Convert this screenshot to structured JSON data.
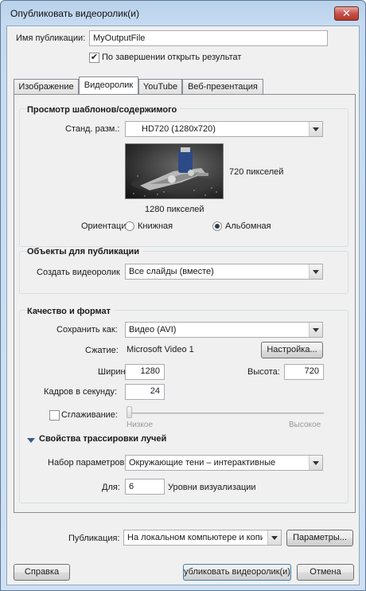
{
  "window": {
    "title": "Опубликовать видеоролик(и)",
    "close_glyph": "✕"
  },
  "publication": {
    "name_label": "Имя публикации:",
    "name_value": "MyOutputFile",
    "open_result_label": "По завершении открыть результат",
    "open_result_checked": true
  },
  "tabs": [
    {
      "label": "Изображение",
      "active": false
    },
    {
      "label": "Видеоролик",
      "active": true
    },
    {
      "label": "YouTube",
      "active": false
    },
    {
      "label": "Веб-презентация",
      "active": false
    }
  ],
  "preview": {
    "group_title": "Просмотр шаблонов/содержимого",
    "size_label": "Станд. разм.:",
    "size_value": "HD720 (1280x720)",
    "height_label": "720 пикселей",
    "width_label": "1280 пикселей",
    "orientation_label": "Ориентация:",
    "portrait_label": "Книжная",
    "landscape_label": "Альбомная",
    "selected_orientation": "landscape"
  },
  "objects": {
    "group_title": "Объекты для публикации",
    "create_label": "Создать видеоролик",
    "create_value": "Все слайды (вместе)"
  },
  "quality": {
    "group_title": "Качество и формат",
    "save_as_label": "Сохранить как:",
    "save_as_value": "Видео (AVI)",
    "compression_label": "Сжатие:",
    "compression_value": "Microsoft Video 1",
    "settings_button": "Настройка...",
    "width_label": "Ширина:",
    "width_value": "1280",
    "height_label": "Высота:",
    "height_value": "720",
    "fps_label": "Кадров в секунду:",
    "fps_value": "24",
    "smoothing_label": "Сглаживание:",
    "smoothing_checked": false,
    "slider_low": "Низкое",
    "slider_high": "Высокое",
    "slider_level": 0
  },
  "raytrace": {
    "title": "Свойства трассировки лучей",
    "preset_label": "Набор параметров",
    "preset_value": "Окружающие тени – интерактивные",
    "for_label": "Для:",
    "for_value": "6",
    "levels_label": "Уровни визуализации"
  },
  "publish": {
    "label": "Публикация:",
    "value": "На локальном компьютере и копир",
    "params_button": "Параметры..."
  },
  "footer": {
    "help_button": "Справка",
    "publish_button": "убликовать видеоролик(и)",
    "cancel_button": "Отмена"
  }
}
